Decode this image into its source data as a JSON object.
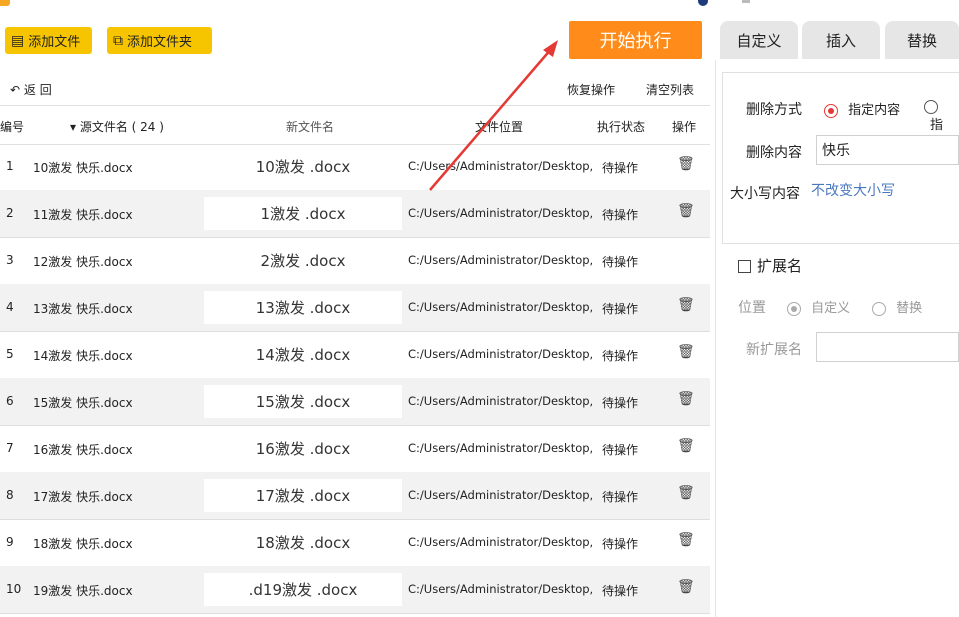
{
  "toolbar": {
    "add_file": "添加文件",
    "add_folder": "添加文件夹",
    "start": "开始执行"
  },
  "right_tabs": [
    "自定义",
    "插入",
    "替换"
  ],
  "list": {
    "back": "返 回",
    "restore": "恢复操作",
    "clear": "清空列表",
    "headers": {
      "num": "编号",
      "src": "▾ 源文件名 ( 24 )",
      "new": "新文件名",
      "loc": "文件位置",
      "status": "执行状态",
      "op": "操作"
    },
    "rows": [
      {
        "num": "1",
        "src": "10激发 快乐.docx",
        "new": "10激发 .docx",
        "loc": "C:/Users/Administrator/Desktop,",
        "status": "待操作"
      },
      {
        "num": "2",
        "src": "11激发 快乐.docx",
        "new": "1激发 .docx",
        "loc": "C:/Users/Administrator/Desktop,",
        "status": "待操作"
      },
      {
        "num": "3",
        "src": "12激发 快乐.docx",
        "new": "2激发 .docx",
        "loc": "C:/Users/Administrator/Desktop,",
        "status": "待操作"
      },
      {
        "num": "4",
        "src": "13激发 快乐.docx",
        "new": "13激发 .docx",
        "loc": "C:/Users/Administrator/Desktop,",
        "status": "待操作"
      },
      {
        "num": "5",
        "src": "14激发 快乐.docx",
        "new": "14激发 .docx",
        "loc": "C:/Users/Administrator/Desktop,",
        "status": "待操作"
      },
      {
        "num": "6",
        "src": "15激发 快乐.docx",
        "new": "15激发 .docx",
        "loc": "C:/Users/Administrator/Desktop,",
        "status": "待操作"
      },
      {
        "num": "7",
        "src": "16激发 快乐.docx",
        "new": "16激发 .docx",
        "loc": "C:/Users/Administrator/Desktop,",
        "status": "待操作"
      },
      {
        "num": "8",
        "src": "17激发 快乐.docx",
        "new": "17激发 .docx",
        "loc": "C:/Users/Administrator/Desktop,",
        "status": "待操作"
      },
      {
        "num": "9",
        "src": "18激发 快乐.docx",
        "new": "18激发 .docx",
        "loc": "C:/Users/Administrator/Desktop,",
        "status": "待操作"
      },
      {
        "num": "10",
        "src": "19激发 快乐.docx",
        "new": ".d19激发 .docx",
        "loc": "C:/Users/Administrator/Desktop,",
        "status": "待操作"
      }
    ]
  },
  "panel": {
    "mode_label": "删除方式",
    "mode_opt1": "指定内容",
    "mode_opt2": "指",
    "content_label": "删除内容",
    "content_value": "快乐",
    "case_label": "大小写内容",
    "case_value": "不改变大小写",
    "ext_label": "扩展名",
    "pos_label": "位置",
    "pos_opt1": "自定义",
    "pos_opt2": "替换",
    "newext_label": "新扩展名"
  },
  "colors": {
    "accent_yellow": "#f7c500",
    "start_orange": "#ff8c1a",
    "radio_red": "#e53935"
  }
}
